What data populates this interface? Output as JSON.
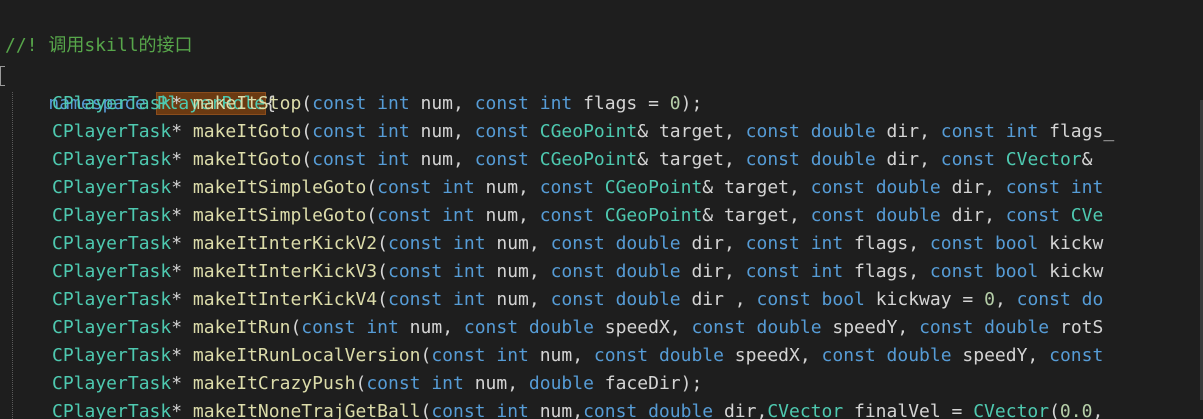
{
  "editor": {
    "comment": "//! 调用skill的接口",
    "ns_keyword": "namespace",
    "ns_name": "PlayerRole",
    "ns_brace": "{",
    "lines": [
      {
        "ret": "CPlayerTask",
        "ptr": "* ",
        "fn": "makeItStop",
        "args": [
          {
            "t": "plain",
            "v": "("
          },
          {
            "t": "kw",
            "v": "const"
          },
          {
            "t": "plain",
            "v": " "
          },
          {
            "t": "kw",
            "v": "int"
          },
          {
            "t": "plain",
            "v": " num, "
          },
          {
            "t": "kw",
            "v": "const"
          },
          {
            "t": "plain",
            "v": " "
          },
          {
            "t": "kw",
            "v": "int"
          },
          {
            "t": "plain",
            "v": " flags = "
          },
          {
            "t": "num",
            "v": "0"
          },
          {
            "t": "plain",
            "v": ");"
          }
        ]
      },
      {
        "ret": "CPlayerTask",
        "ptr": "* ",
        "fn": "makeItGoto",
        "args": [
          {
            "t": "plain",
            "v": "("
          },
          {
            "t": "kw",
            "v": "const"
          },
          {
            "t": "plain",
            "v": " "
          },
          {
            "t": "kw",
            "v": "int"
          },
          {
            "t": "plain",
            "v": " num, "
          },
          {
            "t": "kw",
            "v": "const"
          },
          {
            "t": "plain",
            "v": " "
          },
          {
            "t": "type",
            "v": "CGeoPoint"
          },
          {
            "t": "plain",
            "v": "& target, "
          },
          {
            "t": "kw",
            "v": "const"
          },
          {
            "t": "plain",
            "v": " "
          },
          {
            "t": "kw",
            "v": "double"
          },
          {
            "t": "plain",
            "v": " dir, "
          },
          {
            "t": "kw",
            "v": "const"
          },
          {
            "t": "plain",
            "v": " "
          },
          {
            "t": "kw",
            "v": "int"
          },
          {
            "t": "plain",
            "v": " flags_"
          }
        ]
      },
      {
        "ret": "CPlayerTask",
        "ptr": "* ",
        "fn": "makeItGoto",
        "args": [
          {
            "t": "plain",
            "v": "("
          },
          {
            "t": "kw",
            "v": "const"
          },
          {
            "t": "plain",
            "v": " "
          },
          {
            "t": "kw",
            "v": "int"
          },
          {
            "t": "plain",
            "v": " num, "
          },
          {
            "t": "kw",
            "v": "const"
          },
          {
            "t": "plain",
            "v": " "
          },
          {
            "t": "type",
            "v": "CGeoPoint"
          },
          {
            "t": "plain",
            "v": "& target, "
          },
          {
            "t": "kw",
            "v": "const"
          },
          {
            "t": "plain",
            "v": " "
          },
          {
            "t": "kw",
            "v": "double"
          },
          {
            "t": "plain",
            "v": " dir, "
          },
          {
            "t": "kw",
            "v": "const"
          },
          {
            "t": "plain",
            "v": " "
          },
          {
            "t": "type",
            "v": "CVector"
          },
          {
            "t": "plain",
            "v": "& "
          }
        ]
      },
      {
        "ret": "CPlayerTask",
        "ptr": "* ",
        "fn": "makeItSimpleGoto",
        "args": [
          {
            "t": "plain",
            "v": "("
          },
          {
            "t": "kw",
            "v": "const"
          },
          {
            "t": "plain",
            "v": " "
          },
          {
            "t": "kw",
            "v": "int"
          },
          {
            "t": "plain",
            "v": " num, "
          },
          {
            "t": "kw",
            "v": "const"
          },
          {
            "t": "plain",
            "v": " "
          },
          {
            "t": "type",
            "v": "CGeoPoint"
          },
          {
            "t": "plain",
            "v": "& target, "
          },
          {
            "t": "kw",
            "v": "const"
          },
          {
            "t": "plain",
            "v": " "
          },
          {
            "t": "kw",
            "v": "double"
          },
          {
            "t": "plain",
            "v": " dir, "
          },
          {
            "t": "kw",
            "v": "const"
          },
          {
            "t": "plain",
            "v": " "
          },
          {
            "t": "kw",
            "v": "int"
          }
        ]
      },
      {
        "ret": "CPlayerTask",
        "ptr": "* ",
        "fn": "makeItSimpleGoto",
        "args": [
          {
            "t": "plain",
            "v": "("
          },
          {
            "t": "kw",
            "v": "const"
          },
          {
            "t": "plain",
            "v": " "
          },
          {
            "t": "kw",
            "v": "int"
          },
          {
            "t": "plain",
            "v": " num, "
          },
          {
            "t": "kw",
            "v": "const"
          },
          {
            "t": "plain",
            "v": " "
          },
          {
            "t": "type",
            "v": "CGeoPoint"
          },
          {
            "t": "plain",
            "v": "& target, "
          },
          {
            "t": "kw",
            "v": "const"
          },
          {
            "t": "plain",
            "v": " "
          },
          {
            "t": "kw",
            "v": "double"
          },
          {
            "t": "plain",
            "v": " dir, "
          },
          {
            "t": "kw",
            "v": "const"
          },
          {
            "t": "plain",
            "v": " "
          },
          {
            "t": "type",
            "v": "CVe"
          }
        ]
      },
      {
        "ret": "CPlayerTask",
        "ptr": "* ",
        "fn": "makeItInterKickV2",
        "args": [
          {
            "t": "plain",
            "v": "("
          },
          {
            "t": "kw",
            "v": "const"
          },
          {
            "t": "plain",
            "v": " "
          },
          {
            "t": "kw",
            "v": "int"
          },
          {
            "t": "plain",
            "v": " num, "
          },
          {
            "t": "kw",
            "v": "const"
          },
          {
            "t": "plain",
            "v": " "
          },
          {
            "t": "kw",
            "v": "double"
          },
          {
            "t": "plain",
            "v": " dir, "
          },
          {
            "t": "kw",
            "v": "const"
          },
          {
            "t": "plain",
            "v": " "
          },
          {
            "t": "kw",
            "v": "int"
          },
          {
            "t": "plain",
            "v": " flags, "
          },
          {
            "t": "kw",
            "v": "const"
          },
          {
            "t": "plain",
            "v": " "
          },
          {
            "t": "kw",
            "v": "bool"
          },
          {
            "t": "plain",
            "v": " kickw"
          }
        ]
      },
      {
        "ret": "CPlayerTask",
        "ptr": "* ",
        "fn": "makeItInterKickV3",
        "args": [
          {
            "t": "plain",
            "v": "("
          },
          {
            "t": "kw",
            "v": "const"
          },
          {
            "t": "plain",
            "v": " "
          },
          {
            "t": "kw",
            "v": "int"
          },
          {
            "t": "plain",
            "v": " num, "
          },
          {
            "t": "kw",
            "v": "const"
          },
          {
            "t": "plain",
            "v": " "
          },
          {
            "t": "kw",
            "v": "double"
          },
          {
            "t": "plain",
            "v": " dir, "
          },
          {
            "t": "kw",
            "v": "const"
          },
          {
            "t": "plain",
            "v": " "
          },
          {
            "t": "kw",
            "v": "int"
          },
          {
            "t": "plain",
            "v": " flags, "
          },
          {
            "t": "kw",
            "v": "const"
          },
          {
            "t": "plain",
            "v": " "
          },
          {
            "t": "kw",
            "v": "bool"
          },
          {
            "t": "plain",
            "v": " kickw"
          }
        ]
      },
      {
        "ret": "CPlayerTask",
        "ptr": "* ",
        "fn": "makeItInterKickV4",
        "args": [
          {
            "t": "plain",
            "v": "("
          },
          {
            "t": "kw",
            "v": "const"
          },
          {
            "t": "plain",
            "v": " "
          },
          {
            "t": "kw",
            "v": "int"
          },
          {
            "t": "plain",
            "v": " num, "
          },
          {
            "t": "kw",
            "v": "const"
          },
          {
            "t": "plain",
            "v": " "
          },
          {
            "t": "kw",
            "v": "double"
          },
          {
            "t": "plain",
            "v": " dir , "
          },
          {
            "t": "kw",
            "v": "const"
          },
          {
            "t": "plain",
            "v": " "
          },
          {
            "t": "kw",
            "v": "bool"
          },
          {
            "t": "plain",
            "v": " kickway = "
          },
          {
            "t": "num",
            "v": "0"
          },
          {
            "t": "plain",
            "v": ", "
          },
          {
            "t": "kw",
            "v": "const"
          },
          {
            "t": "plain",
            "v": " "
          },
          {
            "t": "kw",
            "v": "do"
          }
        ]
      },
      {
        "ret": "CPlayerTask",
        "ptr": "* ",
        "fn": "makeItRun",
        "args": [
          {
            "t": "plain",
            "v": "("
          },
          {
            "t": "kw",
            "v": "const"
          },
          {
            "t": "plain",
            "v": " "
          },
          {
            "t": "kw",
            "v": "int"
          },
          {
            "t": "plain",
            "v": " num, "
          },
          {
            "t": "kw",
            "v": "const"
          },
          {
            "t": "plain",
            "v": " "
          },
          {
            "t": "kw",
            "v": "double"
          },
          {
            "t": "plain",
            "v": " speedX, "
          },
          {
            "t": "kw",
            "v": "const"
          },
          {
            "t": "plain",
            "v": " "
          },
          {
            "t": "kw",
            "v": "double"
          },
          {
            "t": "plain",
            "v": " speedY, "
          },
          {
            "t": "kw",
            "v": "const"
          },
          {
            "t": "plain",
            "v": " "
          },
          {
            "t": "kw",
            "v": "double"
          },
          {
            "t": "plain",
            "v": " rotS"
          }
        ]
      },
      {
        "ret": "CPlayerTask",
        "ptr": "* ",
        "fn": "makeItRunLocalVersion",
        "args": [
          {
            "t": "plain",
            "v": "("
          },
          {
            "t": "kw",
            "v": "const"
          },
          {
            "t": "plain",
            "v": " "
          },
          {
            "t": "kw",
            "v": "int"
          },
          {
            "t": "plain",
            "v": " num, "
          },
          {
            "t": "kw",
            "v": "const"
          },
          {
            "t": "plain",
            "v": " "
          },
          {
            "t": "kw",
            "v": "double"
          },
          {
            "t": "plain",
            "v": " speedX, "
          },
          {
            "t": "kw",
            "v": "const"
          },
          {
            "t": "plain",
            "v": " "
          },
          {
            "t": "kw",
            "v": "double"
          },
          {
            "t": "plain",
            "v": " speedY, "
          },
          {
            "t": "kw",
            "v": "const"
          }
        ]
      },
      {
        "ret": "CPlayerTask",
        "ptr": "* ",
        "fn": "makeItCrazyPush",
        "args": [
          {
            "t": "plain",
            "v": "("
          },
          {
            "t": "kw",
            "v": "const"
          },
          {
            "t": "plain",
            "v": " "
          },
          {
            "t": "kw",
            "v": "int"
          },
          {
            "t": "plain",
            "v": " num, "
          },
          {
            "t": "kw",
            "v": "double"
          },
          {
            "t": "plain",
            "v": " faceDir);"
          }
        ]
      },
      {
        "ret": "CPlayerTask",
        "ptr": "* ",
        "fn": "makeItNoneTrajGetBall",
        "args": [
          {
            "t": "plain",
            "v": "("
          },
          {
            "t": "kw",
            "v": "const"
          },
          {
            "t": "plain",
            "v": " "
          },
          {
            "t": "kw",
            "v": "int"
          },
          {
            "t": "plain",
            "v": " num,"
          },
          {
            "t": "kw",
            "v": "const"
          },
          {
            "t": "plain",
            "v": " "
          },
          {
            "t": "kw",
            "v": "double"
          },
          {
            "t": "plain",
            "v": " dir,"
          },
          {
            "t": "type",
            "v": "CVector"
          },
          {
            "t": "plain",
            "v": " finalVel = "
          },
          {
            "t": "type",
            "v": "CVector"
          },
          {
            "t": "plain",
            "v": "("
          },
          {
            "t": "num",
            "v": "0.0"
          },
          {
            "t": "plain",
            "v": ","
          }
        ]
      }
    ]
  }
}
